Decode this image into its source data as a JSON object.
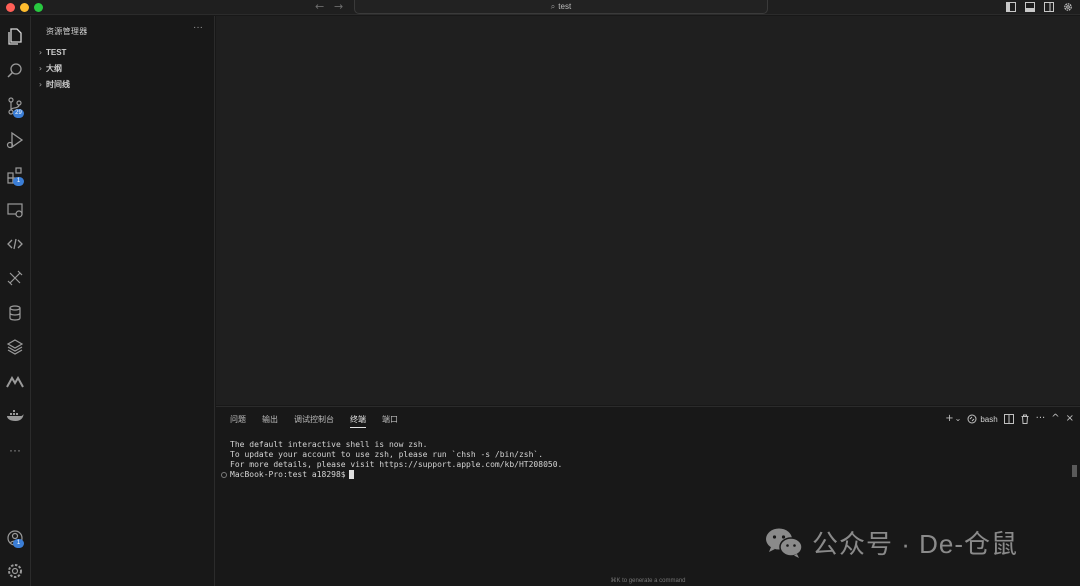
{
  "titlebar": {
    "search_text": "test",
    "back_arrow": "←",
    "forward_arrow": "→"
  },
  "activity_bar": {
    "items": [
      {
        "icon": "files-icon"
      },
      {
        "icon": "search-icon"
      },
      {
        "icon": "source-control-icon",
        "badge": "29"
      },
      {
        "icon": "run-debug-icon"
      },
      {
        "icon": "extensions-icon",
        "badge": "1"
      },
      {
        "icon": "remote-explorer-icon"
      },
      {
        "icon": "code-icon"
      },
      {
        "icon": "test-tube-icon"
      },
      {
        "icon": "database-icon"
      },
      {
        "icon": "layers-icon"
      },
      {
        "icon": "m-logo-icon"
      },
      {
        "icon": "docker-icon"
      },
      {
        "icon": "more-icon",
        "label": "···"
      }
    ],
    "account_badge": "1"
  },
  "sidebar": {
    "title": "资源管理器",
    "more": "···",
    "sections": [
      {
        "label": "TEST"
      },
      {
        "label": "大纲"
      },
      {
        "label": "时间线"
      }
    ]
  },
  "panel": {
    "tabs": [
      {
        "label": "问题",
        "active": false
      },
      {
        "label": "输出",
        "active": false
      },
      {
        "label": "调试控制台",
        "active": false
      },
      {
        "label": "终端",
        "active": true
      },
      {
        "label": "端口",
        "active": false
      }
    ],
    "tools": {
      "add": "+",
      "dropdown": "⌄",
      "shell_name": "bash",
      "more": "···",
      "maximize": "^",
      "close": "×"
    },
    "terminal_lines": [
      "The default interactive shell is now zsh.",
      "To update your account to use zsh, please run `chsh -s /bin/zsh`.",
      "For more details, please visit https://support.apple.com/kb/HT208050."
    ],
    "prompt": "MacBook-Pro:test a18298$",
    "hint": "⌘K to generate a command"
  },
  "watermark": {
    "text": "公众号 · De-仓鼠"
  },
  "colors": {
    "accent": "#3b7ed6",
    "background": "#181818",
    "editor": "#1f1f1f"
  }
}
